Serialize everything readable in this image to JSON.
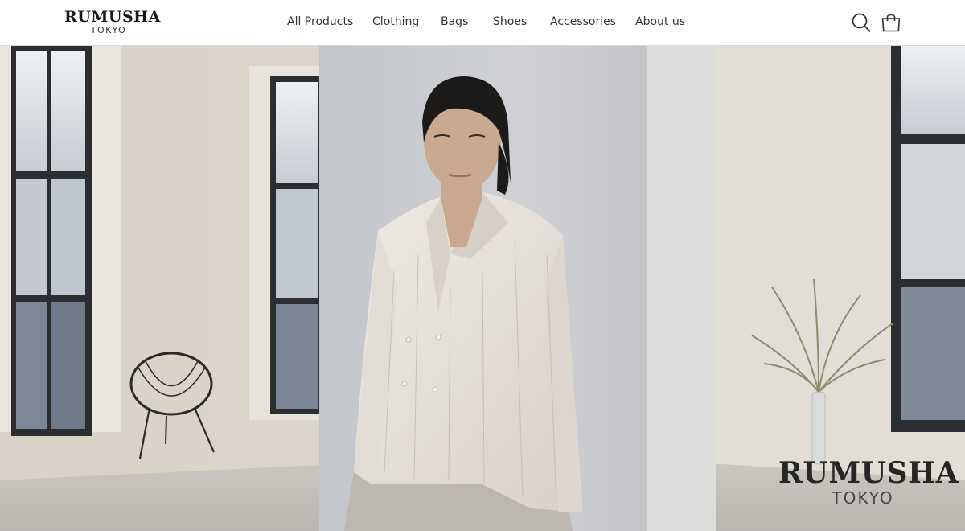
{
  "brand": {
    "name": "RUMUSHA",
    "sub": "TOKYO"
  },
  "nav": {
    "items": [
      {
        "label": "All Products"
      },
      {
        "label": "Clothing"
      },
      {
        "label": "Bags"
      },
      {
        "label": "Shoes"
      },
      {
        "label": "Accessories"
      },
      {
        "label": "About us"
      }
    ]
  },
  "icons": {
    "search": "search-icon",
    "bag": "shopping-bag-icon"
  },
  "hero": {
    "watermark_name": "RUMUSHA",
    "watermark_sub": "TOKYO"
  },
  "colors": {
    "header_bg": "#ffffff",
    "text": "#333333",
    "wall": "#ddd6cc",
    "pillar": "#c9ccd0"
  }
}
